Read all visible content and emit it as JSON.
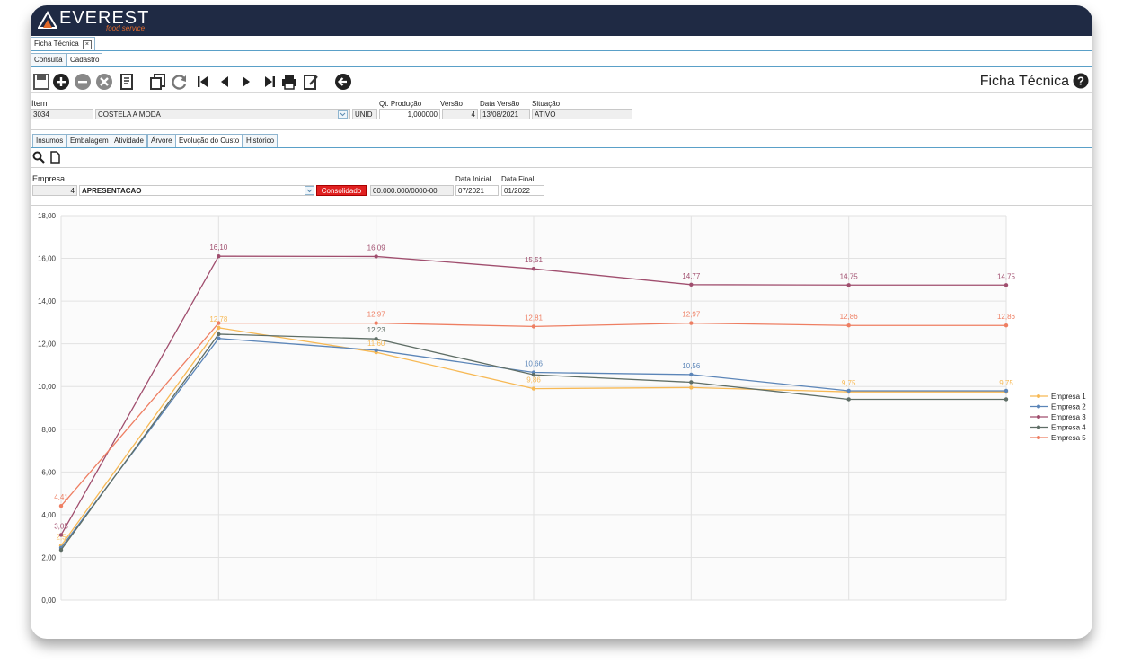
{
  "app": {
    "logo_text": "EVEREST",
    "logo_sub": "food service"
  },
  "window_tabs": [
    {
      "label": "Ficha Técnica"
    }
  ],
  "view_tabs": [
    {
      "label": "Consulta"
    },
    {
      "label": "Cadastro"
    }
  ],
  "page_title": "Ficha Técnica",
  "item": {
    "label": "Item",
    "code": "3034",
    "description": "COSTELA A MODA",
    "unit": "UNID",
    "qt_label": "Qt. Produção",
    "qt_value": "1,000000",
    "versao_label": "Versão",
    "versao_value": "4",
    "data_versao_label": "Data Versão",
    "data_versao_value": "13/08/2021",
    "situacao_label": "Situação",
    "situacao_value": "ATIVO"
  },
  "detail_tabs": [
    "Insumos",
    "Embalagem",
    "Atividade",
    "Árvore",
    "Evolução do Custo",
    "Histórico"
  ],
  "empresa": {
    "label": "Empresa",
    "code": "4",
    "name": "APRESENTACAO",
    "badge": "Consolidado",
    "cnpj": "00.000.000/0000-00",
    "data_inicial_label": "Data Inicial",
    "data_inicial": "07/2021",
    "data_final_label": "Data Final",
    "data_final": "01/2022"
  },
  "chart_data": {
    "type": "line",
    "x": [
      0,
      1,
      2,
      3,
      4,
      5,
      6
    ],
    "ylim": [
      0,
      18
    ],
    "yticks": [
      "0,00",
      "2,00",
      "4,00",
      "6,00",
      "8,00",
      "10,00",
      "12,00",
      "14,00",
      "16,00",
      "18,00"
    ],
    "grid": true,
    "legend": "right",
    "series": [
      {
        "name": "Empresa 1",
        "color": "#f7b955",
        "values": [
          2.55,
          12.75,
          11.6,
          9.9,
          9.95,
          9.75,
          9.75
        ],
        "labels": [
          "2,5",
          "12,78",
          "11,60",
          "9,86",
          "",
          "9,75",
          "9,75"
        ]
      },
      {
        "name": "Empresa 2",
        "color": "#5b85b8",
        "values": [
          2.45,
          12.25,
          11.7,
          10.66,
          10.56,
          9.8,
          9.8
        ],
        "labels": [
          "",
          "",
          "",
          "10,66",
          "10,56",
          "",
          ""
        ]
      },
      {
        "name": "Empresa 3",
        "color": "#a04e6e",
        "values": [
          3.05,
          16.1,
          16.09,
          15.51,
          14.77,
          14.75,
          14.75
        ],
        "labels": [
          "3,05",
          "16,10",
          "16,09",
          "15,51",
          "14,77",
          "14,75",
          "14,75"
        ]
      },
      {
        "name": "Empresa 4",
        "color": "#5f6e66",
        "values": [
          2.35,
          12.45,
          12.23,
          10.55,
          10.2,
          9.4,
          9.4
        ],
        "labels": [
          "",
          "",
          "12,23",
          "",
          "",
          "",
          ""
        ]
      },
      {
        "name": "Empresa 5",
        "color": "#ee7e62",
        "values": [
          4.41,
          12.97,
          12.97,
          12.81,
          12.97,
          12.86,
          12.86
        ],
        "labels": [
          "4,41",
          "",
          "12,97",
          "12,81",
          "12,97",
          "12,86",
          "12,86"
        ]
      }
    ]
  },
  "colors": {
    "header": "#1f2a44",
    "accent": "#e36b2b",
    "tab_border": "#5aa0c8"
  }
}
